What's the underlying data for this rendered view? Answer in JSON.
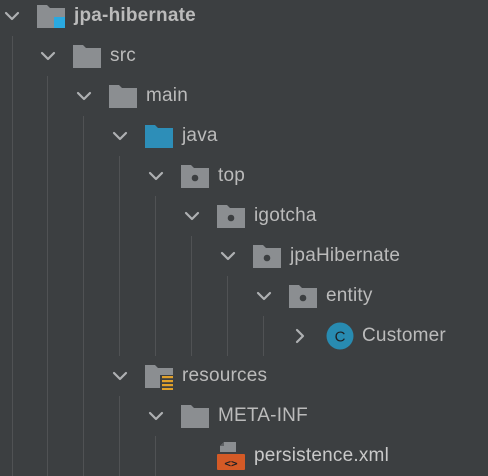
{
  "colors": {
    "background": "#3c3f41",
    "text": "#bbbbbb",
    "folder": "#8b8e91",
    "source_folder": "#2d8eb8",
    "class_badge": "#288bb1",
    "xml_badge": "#d45a26",
    "module_marker": "#2aa9e0",
    "resources_marker": "#e0a02a"
  },
  "tree": {
    "nodes": [
      {
        "label": "jpa-hibernate",
        "icon": "module-folder-icon",
        "expanded": true
      },
      {
        "label": "src",
        "icon": "folder-icon",
        "expanded": true
      },
      {
        "label": "main",
        "icon": "folder-icon",
        "expanded": true
      },
      {
        "label": "java",
        "icon": "source-folder-icon",
        "expanded": true
      },
      {
        "label": "top",
        "icon": "package-icon",
        "expanded": true
      },
      {
        "label": "igotcha",
        "icon": "package-icon",
        "expanded": true
      },
      {
        "label": "jpaHibernate",
        "icon": "package-icon",
        "expanded": true
      },
      {
        "label": "entity",
        "icon": "package-icon",
        "expanded": true
      },
      {
        "label": "Customer",
        "icon": "class-icon",
        "expanded": false
      },
      {
        "label": "resources",
        "icon": "resources-folder-icon",
        "expanded": true
      },
      {
        "label": "META-INF",
        "icon": "folder-icon",
        "expanded": true
      },
      {
        "label": "persistence.xml",
        "icon": "xml-file-icon"
      }
    ],
    "class_badge_letter": "C",
    "xml_badge_glyph": "<>"
  }
}
